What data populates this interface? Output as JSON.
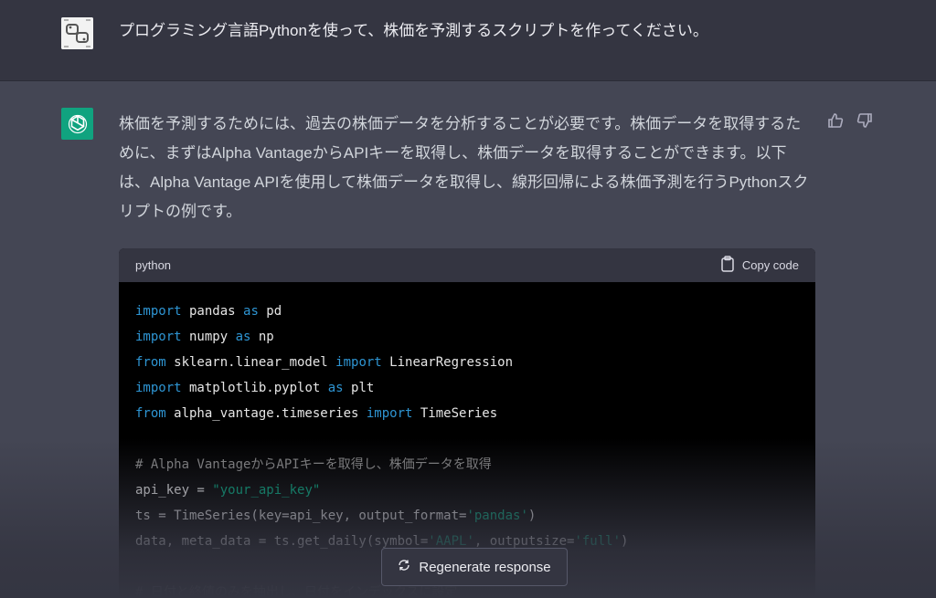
{
  "user": {
    "avatar_icon": "user-avatar-icon",
    "message": "プログラミング言語Pythonを使って、株価を予測するスクリプトを作ってください。"
  },
  "assistant": {
    "avatar_icon": "openai-logo-icon",
    "message": "株価を予測するためには、過去の株価データを分析することが必要です。株価データを取得するために、まずはAlpha VantageからAPIキーを取得し、株価データを取得することができます。以下は、Alpha Vantage APIを使用して株価データを取得し、線形回帰による株価予測を行うPythonスクリプトの例です。",
    "feedback": {
      "thumbs_up_icon": "thumbs-up-icon",
      "thumbs_down_icon": "thumbs-down-icon"
    }
  },
  "code": {
    "language": "python",
    "copy_label": "Copy code",
    "lines": [
      [
        {
          "t": "import",
          "c": "kw"
        },
        {
          "t": " pandas "
        },
        {
          "t": "as",
          "c": "kw"
        },
        {
          "t": " pd"
        }
      ],
      [
        {
          "t": "import",
          "c": "kw"
        },
        {
          "t": " numpy "
        },
        {
          "t": "as",
          "c": "kw"
        },
        {
          "t": " np"
        }
      ],
      [
        {
          "t": "from",
          "c": "kw"
        },
        {
          "t": " sklearn.linear_model "
        },
        {
          "t": "import",
          "c": "kw"
        },
        {
          "t": " LinearRegression"
        }
      ],
      [
        {
          "t": "import",
          "c": "kw"
        },
        {
          "t": " matplotlib.pyplot "
        },
        {
          "t": "as",
          "c": "kw"
        },
        {
          "t": " plt"
        }
      ],
      [
        {
          "t": "from",
          "c": "kw"
        },
        {
          "t": " alpha_vantage.timeseries "
        },
        {
          "t": "import",
          "c": "kw"
        },
        {
          "t": " TimeSeries"
        }
      ],
      [],
      [
        {
          "t": "# Alpha VantageからAPIキーを取得し、株価データを取得",
          "c": "cmt"
        }
      ],
      [
        {
          "t": "api_key = "
        },
        {
          "t": "\"your_api_key\"",
          "c": "str"
        }
      ],
      [
        {
          "t": "ts = TimeSeries(key=api_key, output_format="
        },
        {
          "t": "'pandas'",
          "c": "str"
        },
        {
          "t": ")"
        }
      ],
      [
        {
          "t": "data, meta_data = ts.get_daily(symbol="
        },
        {
          "t": "'AAPL'",
          "c": "str"
        },
        {
          "t": ", outputsize="
        },
        {
          "t": "'full'",
          "c": "str"
        },
        {
          "t": ")"
        }
      ],
      [],
      [
        {
          "t": "# 日付と終値のみを抽出し、日付をインデックスに設定",
          "c": "cmt"
        }
      ]
    ]
  },
  "regenerate": {
    "label": "Regenerate response",
    "icon": "refresh-icon"
  },
  "colors": {
    "background": "#444654",
    "user_row": "#343541",
    "accent": "#10a37f",
    "code_bg": "#000000"
  }
}
